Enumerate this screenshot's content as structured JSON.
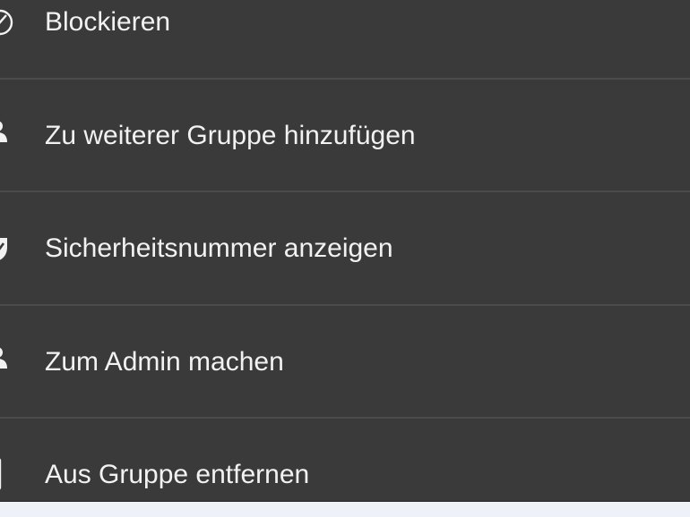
{
  "menu": {
    "items": [
      {
        "label": "Blockieren",
        "icon": "block-icon"
      },
      {
        "label": "Zu weiterer Gruppe hinzufügen",
        "icon": "person-add-icon"
      },
      {
        "label": "Sicherheitsnummer anzeigen",
        "icon": "shield-check-icon"
      },
      {
        "label": "Zum Admin machen",
        "icon": "person-admin-icon"
      },
      {
        "label": "Aus Gruppe entfernen",
        "icon": "remove-from-group-icon"
      }
    ]
  },
  "colors": {
    "sheet_background": "#3a3a3a",
    "text": "#f2f2f2",
    "divider": "#4b4b4b",
    "page_background": "#eef2f8"
  }
}
